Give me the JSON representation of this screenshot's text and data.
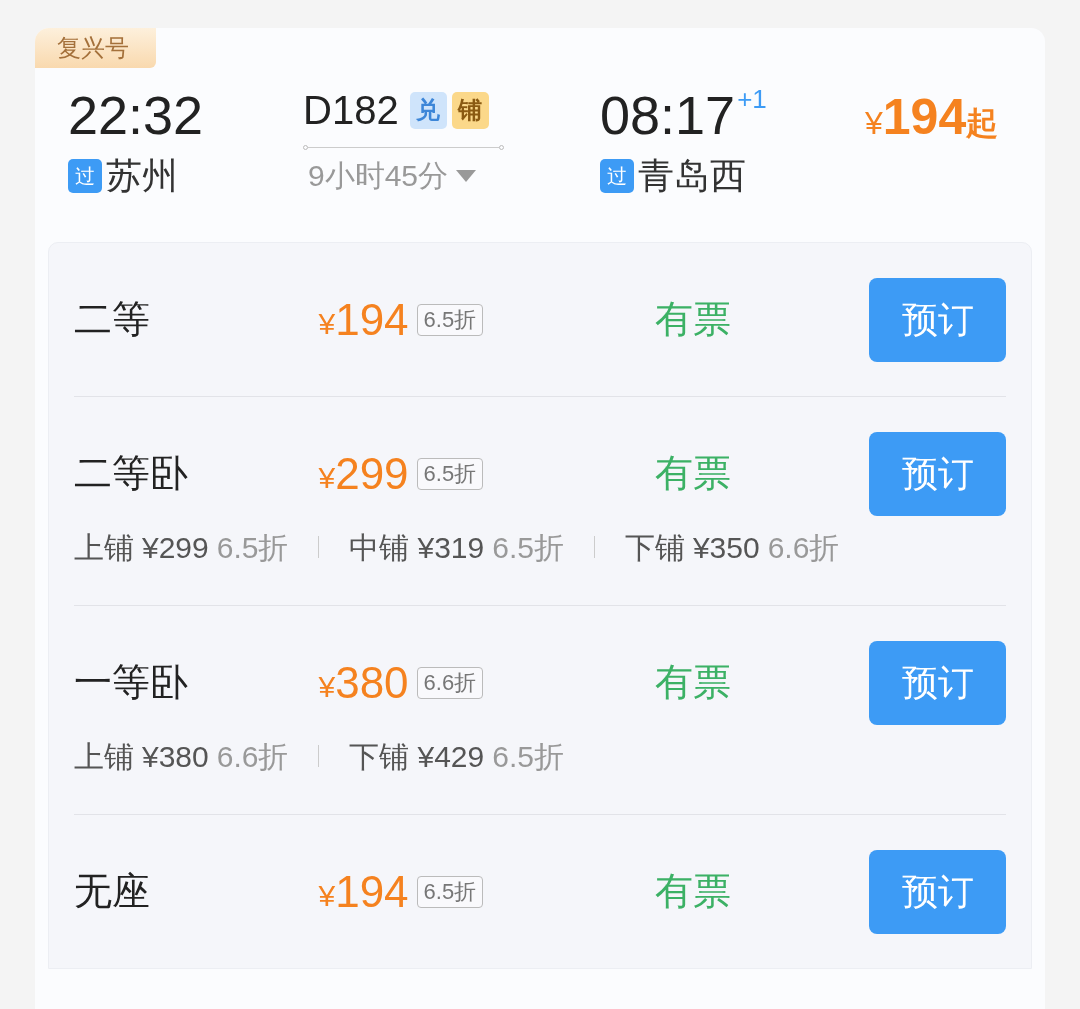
{
  "train_type": "复兴号",
  "departure": {
    "time": "22:32",
    "pass_badge": "过",
    "station": "苏州"
  },
  "train": {
    "number": "D182",
    "tags": [
      {
        "text": "兑",
        "kind": "exchange"
      },
      {
        "text": "铺",
        "kind": "berth"
      }
    ],
    "duration": "9小时45分"
  },
  "arrival": {
    "time": "08:17",
    "day_offset": "+1",
    "pass_badge": "过",
    "station": "青岛西"
  },
  "lowest_price": {
    "currency": "¥",
    "amount": "194",
    "suffix": "起"
  },
  "seats": [
    {
      "name": "二等",
      "currency": "¥",
      "price": "194",
      "discount": "6.5折",
      "availability": "有票",
      "button": "预订"
    },
    {
      "name": "二等卧",
      "currency": "¥",
      "price": "299",
      "discount": "6.5折",
      "availability": "有票",
      "button": "预订",
      "berths": [
        {
          "label": "上铺",
          "price": "¥299",
          "discount": "6.5折"
        },
        {
          "label": "中铺",
          "price": "¥319",
          "discount": "6.5折"
        },
        {
          "label": "下铺",
          "price": "¥350",
          "discount": "6.6折"
        }
      ]
    },
    {
      "name": "一等卧",
      "currency": "¥",
      "price": "380",
      "discount": "6.6折",
      "availability": "有票",
      "button": "预订",
      "berths": [
        {
          "label": "上铺",
          "price": "¥380",
          "discount": "6.6折"
        },
        {
          "label": "下铺",
          "price": "¥429",
          "discount": "6.5折"
        }
      ]
    },
    {
      "name": "无座",
      "currency": "¥",
      "price": "194",
      "discount": "6.5折",
      "availability": "有票",
      "button": "预订"
    }
  ]
}
